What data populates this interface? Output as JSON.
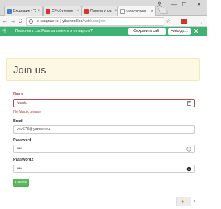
{
  "browser": {
    "tabs": [
      {
        "label": "Входящие - \"Сп",
        "close": "×",
        "favicon": "blue"
      },
      {
        "label": "CF обучение",
        "close": "×",
        "favicon": "red"
      },
      {
        "label": "Панель упра",
        "close": "×",
        "favicon": "red"
      },
      {
        "label": "Videoschool",
        "close": "×",
        "favicon": "doc"
      }
    ],
    "window_controls": {
      "minimize": "—",
      "maximize": "☐",
      "close": "✕"
    },
    "nav": {
      "back": "←",
      "forward": "→",
      "reload": "C"
    },
    "address": {
      "security_label": "Не защищено",
      "host": "yiischool.loc",
      "path": "/web/user/join"
    },
    "menu": "⋮"
  },
  "lastpass": {
    "logo": "•••|",
    "prompt": "Позволить LastPass запомнить этот пароль?",
    "save_label": "Сохранить сайт",
    "never_label": "Никогда...",
    "close": "✕",
    "color": "#3cb371"
  },
  "page": {
    "title": "Join us",
    "form": {
      "name_label": "Name",
      "name_value": "Magic",
      "name_error": "No Magic please",
      "email_label": "Email",
      "email_value": "vev678@yandex.ru",
      "password_label": "Password",
      "password_value": "••••",
      "password2_label": "Password2",
      "password2_value": "••••",
      "submit_label": "Create"
    }
  },
  "colors": {
    "error": "#b94a48",
    "jumbotron_bg": "#fcf8e3",
    "button_green": "#5cb85c"
  }
}
